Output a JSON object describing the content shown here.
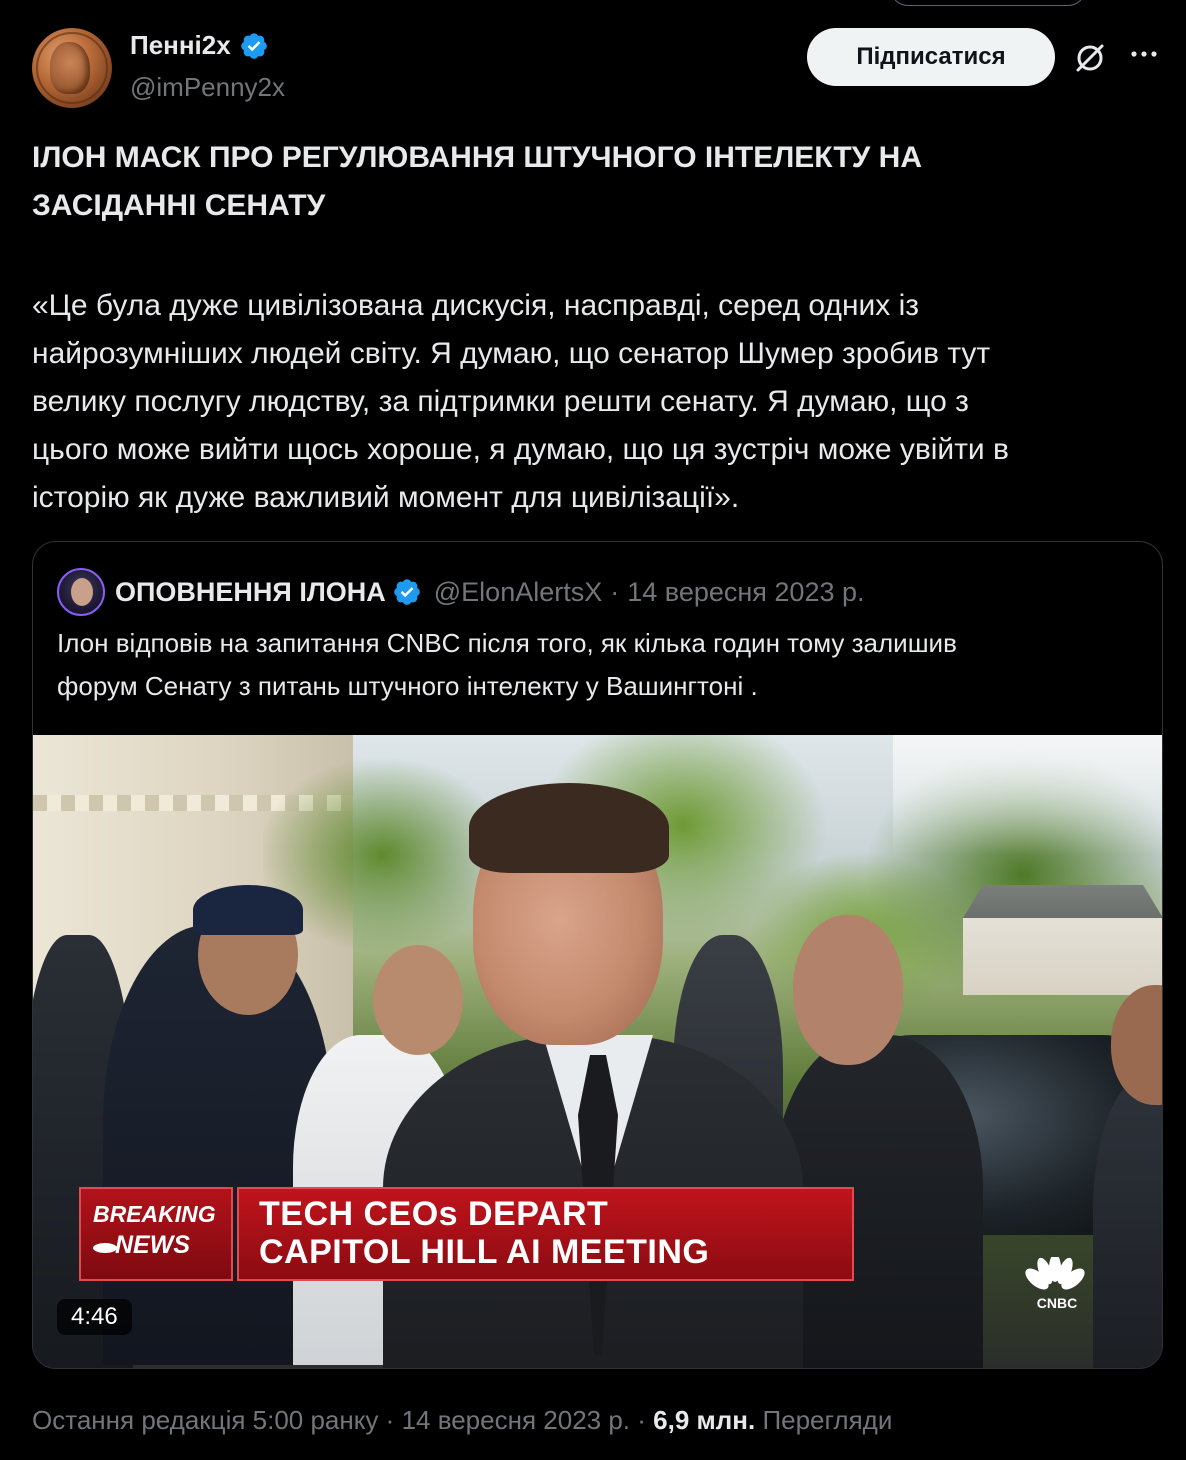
{
  "author": {
    "display_name": "Пенні2x",
    "handle": "@imPenny2x",
    "follow_label": "Підписатися"
  },
  "tweet": {
    "headline_line1": "ІЛОН МАСК ПРО РЕГУЛЮВАННЯ ШТУЧНОГО ІНТЕЛЕКТУ НА",
    "headline_line2": "ЗАСІДАННІ СЕНАТУ",
    "quote_line1": "«Це була дуже цивілізована дискусія, насправді, серед одних із",
    "quote_line2": "найрозумніших людей світу. Я думаю, що сенатор Шумер зробив тут",
    "quote_line3": "велику послугу людству, за підтримки решти сенату. Я думаю, що з",
    "quote_line4": "цього може вийти щось хороше, я думаю, що ця зустріч може увійти в",
    "quote_line5": "історію як дуже важливий момент для цивілізації»."
  },
  "quoted": {
    "display_name": "ОПОВНЕННЯ ІЛОНА",
    "handle": "@ElonAlertsX",
    "separator": "·",
    "date": "14 вересня 2023 р.",
    "text_line1": "Ілон відповів на запитання CNBC після того, як кілька годин тому залишив",
    "text_line2": "форум Сенату з питань штучного інтелекту у Вашингтоні ."
  },
  "video": {
    "breaking_1": "BREAKING",
    "breaking_2": "NEWS",
    "headline_1": "TECH CEOs DEPART",
    "headline_2": "CAPITOL HILL AI MEETING",
    "network": "CNBC",
    "duration": "4:46"
  },
  "meta": {
    "edited": "Остання редакція 5:00 ранку",
    "sep1": "·",
    "date": "14 вересня 2023 р.",
    "sep2": "·",
    "views_count": "6,9 млн.",
    "views_label": "Перегляди"
  },
  "icons": {
    "verified": "verified-badge-icon",
    "grok": "grok-icon",
    "more": "more-icon"
  },
  "colors": {
    "background": "#000000",
    "text": "#e7e9ea",
    "muted": "#71767b",
    "verified_blue": "#1d9bf0",
    "follow_bg": "#eff3f4",
    "border": "#2f3336",
    "breaking_red": "#c0141c"
  }
}
